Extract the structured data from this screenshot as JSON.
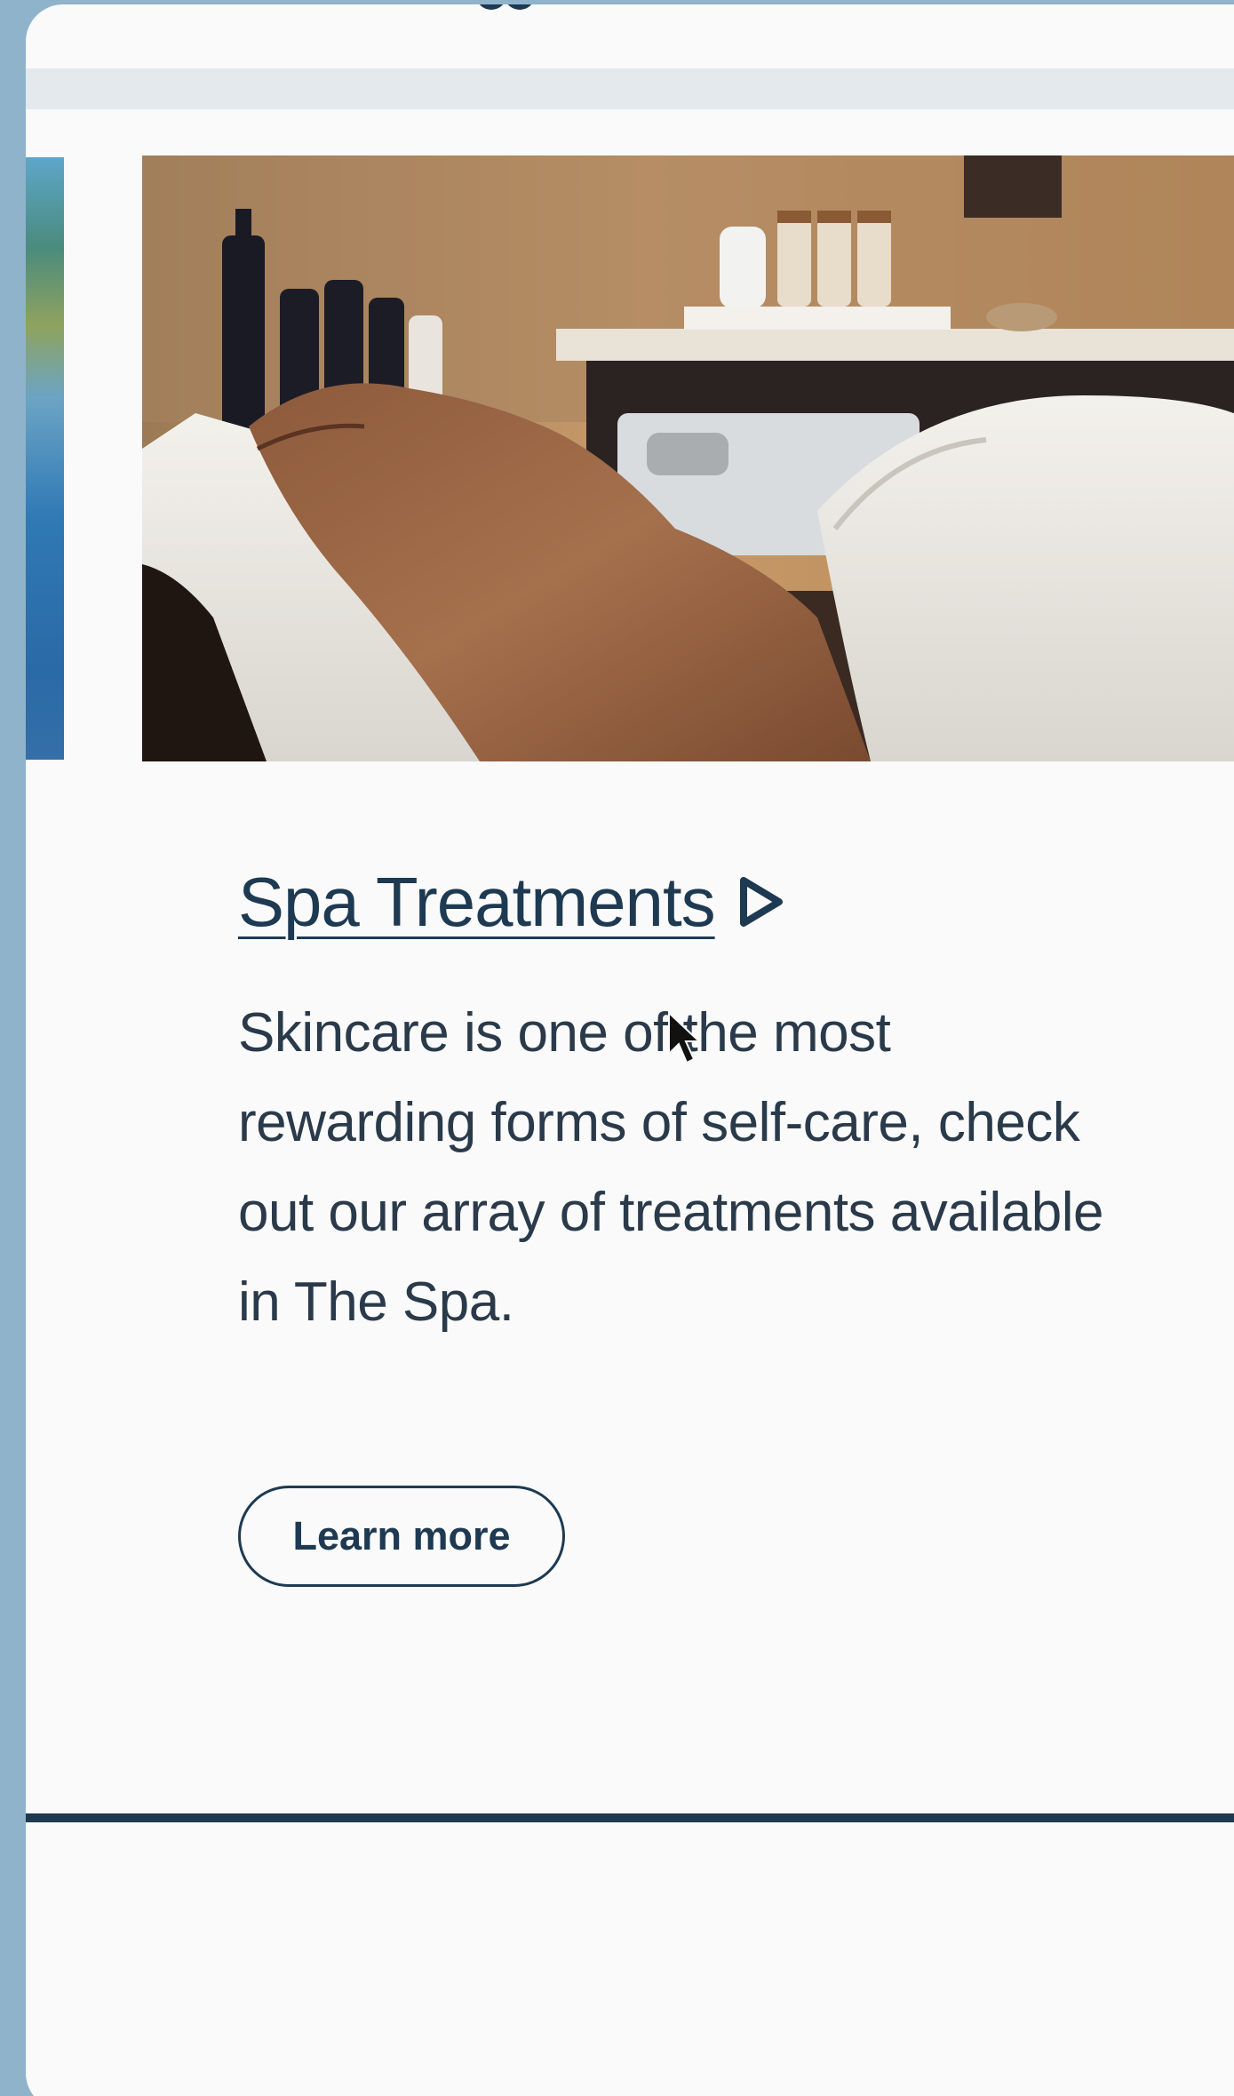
{
  "card": {
    "title": "Spa Treatments",
    "description": "Skincare is one of the most rewarding forms of self-care, check out our array of treatments available in The Spa.",
    "button_label": "Learn more"
  },
  "icons": {
    "title_arrow": "play-triangle-icon",
    "pointer": "mouse-cursor-icon"
  },
  "colors": {
    "outer_background": "#8fb3cb",
    "panel_background": "#fafafa",
    "header_band": "#e4e9ee",
    "text_primary": "#1e3a52",
    "divider": "#1e3a52"
  }
}
